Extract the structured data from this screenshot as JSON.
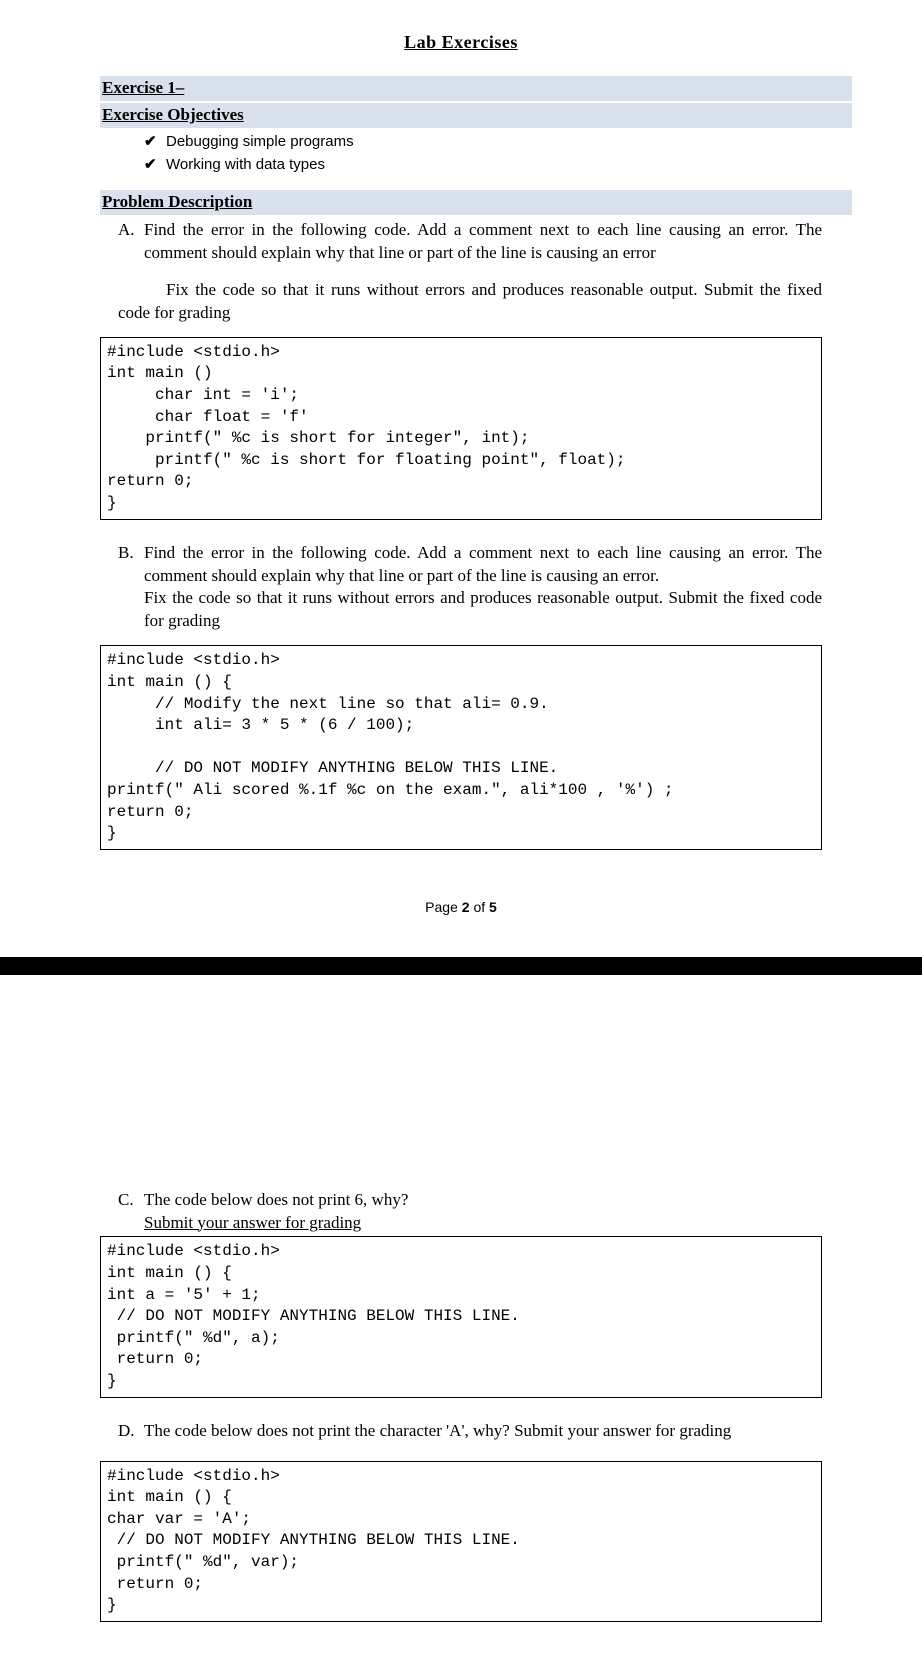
{
  "title": "Lab  Exercises",
  "exercise_heading": "Exercise 1–",
  "objectives_heading": "Exercise Objectives",
  "objectives": [
    "Debugging simple programs",
    "Working with data types"
  ],
  "problem_heading": "Problem Description",
  "items": {
    "A": {
      "letter": "A.",
      "text1": "Find the error in the following code. Add a comment next to each line causing an error. The comment should explain why that line or part of the line is causing an error",
      "text2": "Fix the code so that it runs without errors and produces reasonable output. Submit the fixed code for grading",
      "code": "#include <stdio.h>\nint main ()\n     char int = 'i';\n     char float = 'f'\n    printf(\" %c is short for integer\", int);\n     printf(\" %c is short for floating point\", float);\nreturn 0;\n}"
    },
    "B": {
      "letter": "B.",
      "text1": "Find the error in the following code. Add a comment next to each line causing an error. The comment should explain why that line or part of the line is causing an error.",
      "text2": "Fix the code so that it runs without errors and produces reasonable output. Submit the fixed code for grading",
      "code": "#include <stdio.h>\nint main () {\n     // Modify the next line so that ali= 0.9.\n     int ali= 3 * 5 * (6 / 100);\n\n     // DO NOT MODIFY ANYTHING BELOW THIS LINE.\nprintf(\" Ali scored %.1f %c on the exam.\", ali*100 , '%') ;\nreturn 0;\n}"
    },
    "C": {
      "letter": "C.",
      "text1": "The code below does not print 6, why?",
      "text2": "Submit your answer for grading",
      "code": "#include <stdio.h>\nint main () {\nint a = '5' + 1;\n // DO NOT MODIFY ANYTHING BELOW THIS LINE.\n printf(\" %d\", a);\n return 0;\n}"
    },
    "D": {
      "letter": "D.",
      "text1": "The code below does not print the character 'A', why? Submit your answer for grading",
      "code": "#include <stdio.h>\nint main () {\nchar var = 'A';\n // DO NOT MODIFY ANYTHING BELOW THIS LINE.\n printf(\" %d\", var);\n return 0;\n}"
    }
  },
  "page_number": {
    "pre": "Page ",
    "cur": "2",
    "mid": " of ",
    "total": "5"
  }
}
